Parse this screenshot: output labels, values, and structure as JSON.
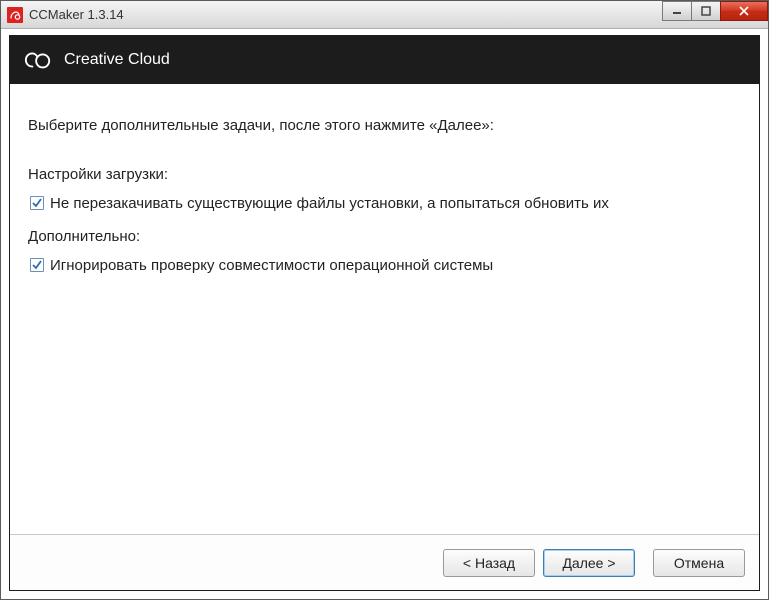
{
  "window": {
    "title": "CCMaker 1.3.14"
  },
  "banner": {
    "title": "Creative Cloud"
  },
  "content": {
    "instruction": "Выберите дополнительные задачи, после этого нажмите «Далее»:",
    "section_download": "Настройки загрузки:",
    "checkbox1_label": "Не перезакачивать существующие файлы установки, а попытаться обновить их",
    "section_extra": "Дополнительно:",
    "checkbox2_label": "Игнорировать проверку совместимости операционной системы"
  },
  "footer": {
    "back_label": "< Назад",
    "next_label": "Далее >",
    "cancel_label": "Отмена"
  }
}
